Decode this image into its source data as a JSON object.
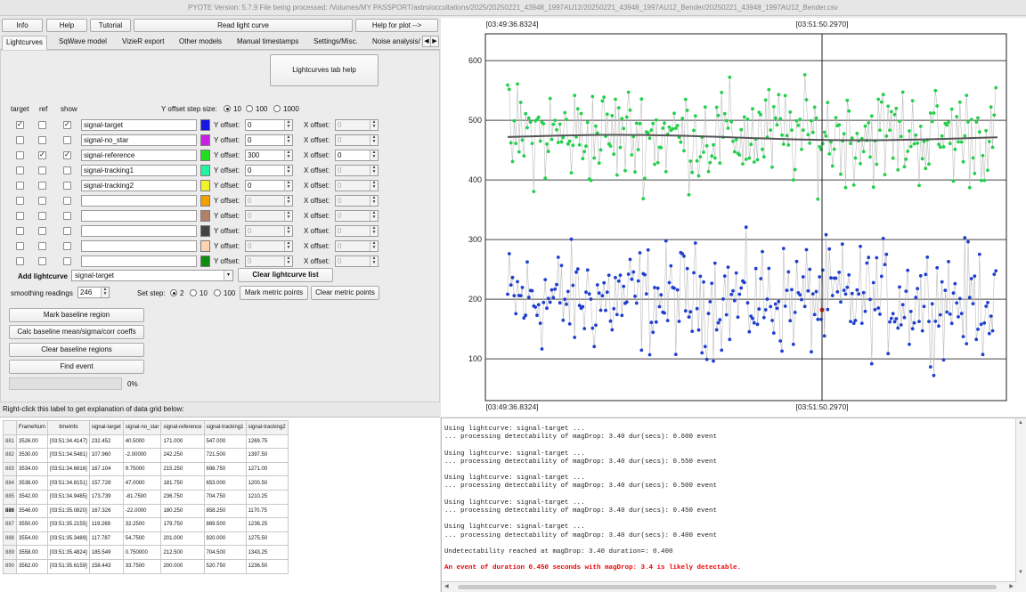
{
  "window": {
    "title": "PYOTE Version: 5.7.9  File being processed: /Volumes/MY PASSPORT/astro/occultations/2025/20250221_43948_1997AU12/20250221_43948_1997AU12_Bender/20250221_43948_1997AU12_Bender.csv"
  },
  "toolbar": {
    "info": "Info",
    "help": "Help",
    "tutorial": "Tutorial",
    "read_light_curve": "Read light curve",
    "help_for_plot": "Help for plot -->"
  },
  "tabs": [
    "Lightcurves",
    "SqWave model",
    "VizieR export",
    "Other models",
    "Manual timestamps",
    "Settings/Misc.",
    "Noise analysis/"
  ],
  "lightcurves": {
    "help_button": "Lightcurves tab help",
    "col_target": "target",
    "col_ref": "ref",
    "col_show": "show",
    "y_step_label": "Y offset step size:",
    "y_step_options": [
      "10",
      "100",
      "1000"
    ],
    "y_offset_label": "Y offset:",
    "x_offset_label": "X offset:",
    "rows": [
      {
        "name": "signal-target",
        "target": true,
        "ref": false,
        "show": true,
        "color": "#1616e6",
        "y": "0",
        "x": "0",
        "enabled": true
      },
      {
        "name": "signal-no_star",
        "target": false,
        "ref": false,
        "show": false,
        "color": "#c81ee6",
        "y": "0",
        "x": "0",
        "enabled": true
      },
      {
        "name": "signal-reference",
        "target": false,
        "ref": true,
        "show": true,
        "color": "#22dd22",
        "y": "300",
        "x": "0",
        "enabled": true
      },
      {
        "name": "signal-tracking1",
        "target": false,
        "ref": false,
        "show": false,
        "color": "#22f5a0",
        "y": "0",
        "x": "0",
        "enabled": true
      },
      {
        "name": "signal-tracking2",
        "target": false,
        "ref": false,
        "show": false,
        "color": "#f2f22a",
        "y": "0",
        "x": "0",
        "enabled": true
      },
      {
        "name": "",
        "target": false,
        "ref": false,
        "show": false,
        "color": "#f2a000",
        "y": "0",
        "x": "0",
        "enabled": false
      },
      {
        "name": "",
        "target": false,
        "ref": false,
        "show": false,
        "color": "#b0806a",
        "y": "0",
        "x": "0",
        "enabled": false
      },
      {
        "name": "",
        "target": false,
        "ref": false,
        "show": false,
        "color": "#444444",
        "y": "0",
        "x": "0",
        "enabled": false
      },
      {
        "name": "",
        "target": false,
        "ref": false,
        "show": false,
        "color": "#ffd3b0",
        "y": "0",
        "x": "0",
        "enabled": false
      },
      {
        "name": "",
        "target": false,
        "ref": false,
        "show": false,
        "color": "#118a11",
        "y": "0",
        "x": "0",
        "enabled": false
      }
    ],
    "add_label": "Add lightcurve",
    "add_selected": "signal-target",
    "clear_list": "Clear lightcurve list",
    "smoothing_label": "smoothing readings",
    "smoothing_value": "246",
    "set_step_label": "Set step:",
    "set_step_options": [
      "2",
      "10",
      "100"
    ],
    "mark_metric": "Mark metric points",
    "clear_metric": "Clear metric points",
    "mark_baseline": "Mark baseline region",
    "calc_baseline": "Calc baseline mean/sigma/corr coeffs",
    "clear_baseline": "Clear baseline regions",
    "find_event": "Find event",
    "progress_text": "0%",
    "progress_value": 0
  },
  "plot": {
    "top_left_label": "[03:49:36.8324]",
    "top_right_label": "[03:51:50.2970]",
    "bottom_left_label": "[03:49:36.8324]",
    "bottom_right_label": "[03:51:50.2970]",
    "y_ticks": [
      "600",
      "500",
      "400",
      "300",
      "200",
      "100"
    ],
    "target_color": "#1f3fd0",
    "reference_color": "#22d04a",
    "trend_color": "#555555"
  },
  "chart_data": {
    "type": "scatter",
    "title": "",
    "xlabel": "",
    "ylabel": "",
    "ylim": [
      30,
      645
    ],
    "xlim": [
      "03:49:36.8324",
      "03:53:30"
    ],
    "grid": true,
    "series": [
      {
        "name": "signal-target",
        "mean": 200,
        "spread": 60
      },
      {
        "name": "signal-reference",
        "mean": 475,
        "spread": 55
      }
    ]
  },
  "grid_label": "Right-click this label to get explanation of data grid below:",
  "table": {
    "headers": [
      "",
      "FrameNum",
      "timeInfo",
      "signal-target",
      "signal-no_star",
      "signal-reference",
      "signal-tracking1",
      "signal-tracking2"
    ],
    "rows": [
      [
        "881",
        "3526.00",
        "[03:51:34.4147]",
        "232.452",
        "40.5000",
        "171.000",
        "547.000",
        "1269.75"
      ],
      [
        "882",
        "3530.00",
        "[03:51:34.5481]",
        "107.960",
        "-2.00000",
        "242.250",
        "721.500",
        "1397.50"
      ],
      [
        "883",
        "3534.00",
        "[03:51:34.6816]",
        "167.104",
        "9.75000",
        "215.250",
        "698.750",
        "1271.00"
      ],
      [
        "884",
        "3538.00",
        "[03:51:34.8151]",
        "157.728",
        "47.0000",
        "181.750",
        "653.000",
        "1200.50"
      ],
      [
        "885",
        "3542.00",
        "[03:51:34.9485]",
        "173.739",
        "-81.7500",
        "236.750",
        "704.750",
        "1210.25"
      ],
      [
        "886",
        "3546.00",
        "[03:51:35.0820]",
        "167.326",
        "-22.0000",
        "180.250",
        "858.250",
        "1170.75"
      ],
      [
        "887",
        "3550.00",
        "[03:51:35.2155]",
        "119.269",
        "32.2500",
        "179.750",
        "889.500",
        "1236.25"
      ],
      [
        "888",
        "3554.00",
        "[03:51:35.3489]",
        "117.787",
        "54.7500",
        "201.000",
        "920.000",
        "1275.50"
      ],
      [
        "889",
        "3558.00",
        "[03:51:35.4824]",
        "185.549",
        "0.750000",
        "212.500",
        "704.500",
        "1343.25"
      ],
      [
        "890",
        "3562.00",
        "[03:51:35.6159]",
        "158.443",
        "33.7500",
        "200.000",
        "520.750",
        "1236.50"
      ]
    ],
    "selected_row": "886"
  },
  "log": [
    {
      "text": "Using lightcurve: signal-target ...",
      "red": false
    },
    {
      "text": "... processing detectability of magDrop: 3.40 dur(secs): 0.600 event",
      "red": false
    },
    {
      "text": "",
      "red": false
    },
    {
      "text": "Using lightcurve: signal-target ...",
      "red": false
    },
    {
      "text": "... processing detectability of magDrop: 3.40 dur(secs): 0.550 event",
      "red": false
    },
    {
      "text": "",
      "red": false
    },
    {
      "text": "Using lightcurve: signal-target ...",
      "red": false
    },
    {
      "text": "... processing detectability of magDrop: 3.40 dur(secs): 0.500 event",
      "red": false
    },
    {
      "text": "",
      "red": false
    },
    {
      "text": "Using lightcurve: signal-target ...",
      "red": false
    },
    {
      "text": "... processing detectability of magDrop: 3.40 dur(secs): 0.450 event",
      "red": false
    },
    {
      "text": "",
      "red": false
    },
    {
      "text": "Using lightcurve: signal-target ...",
      "red": false
    },
    {
      "text": "... processing detectability of magDrop: 3.40 dur(secs): 0.400 event",
      "red": false
    },
    {
      "text": "",
      "red": false
    },
    {
      "text": "Undetectability reached at magDrop: 3.40 duration=: 0.400",
      "red": false
    },
    {
      "text": "",
      "red": false
    },
    {
      "text": "An event of duration 0.450 seconds with magDrop: 3.4 is likely detectable.",
      "red": true
    }
  ]
}
